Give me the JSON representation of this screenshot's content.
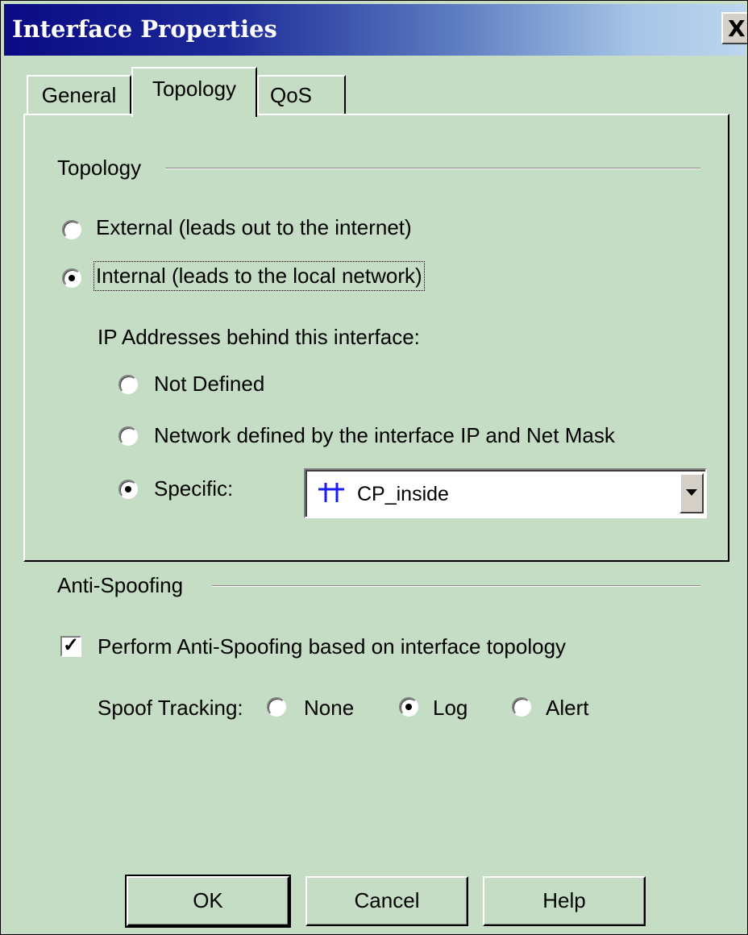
{
  "window": {
    "title": "Interface Properties",
    "close_label": "X"
  },
  "tabs": [
    {
      "label": "General",
      "selected": false
    },
    {
      "label": "Topology",
      "selected": true
    },
    {
      "label": "QoS",
      "selected": false
    }
  ],
  "topology_group": {
    "label": "Topology",
    "external_label": "External (leads out to the internet)",
    "internal_label": "Internal (leads to the local network)",
    "selected": "internal",
    "ip_addresses_label": "IP Addresses behind this interface:",
    "not_defined_label": "Not Defined",
    "network_defined_label": "Network defined by the interface IP and Net Mask",
    "specific_label": "Specific:",
    "ip_selected": "specific",
    "specific_value": "CP_inside",
    "specific_icon": "network-object-icon"
  },
  "anti_spoofing_group": {
    "label": "Anti-Spoofing",
    "perform_label": "Perform Anti-Spoofing based on interface topology",
    "perform_checked": true,
    "spoof_tracking_label": "Spoof Tracking:",
    "none_label": "None",
    "log_label": "Log",
    "alert_label": "Alert",
    "tracking_selected": "log"
  },
  "buttons": {
    "ok": "OK",
    "cancel": "Cancel",
    "help": "Help"
  },
  "colors": {
    "dialog_bg": "#c5dcc5",
    "title_start": "#0a0a84",
    "title_end": "#bcd6ee",
    "network_icon": "#1a1aff"
  }
}
